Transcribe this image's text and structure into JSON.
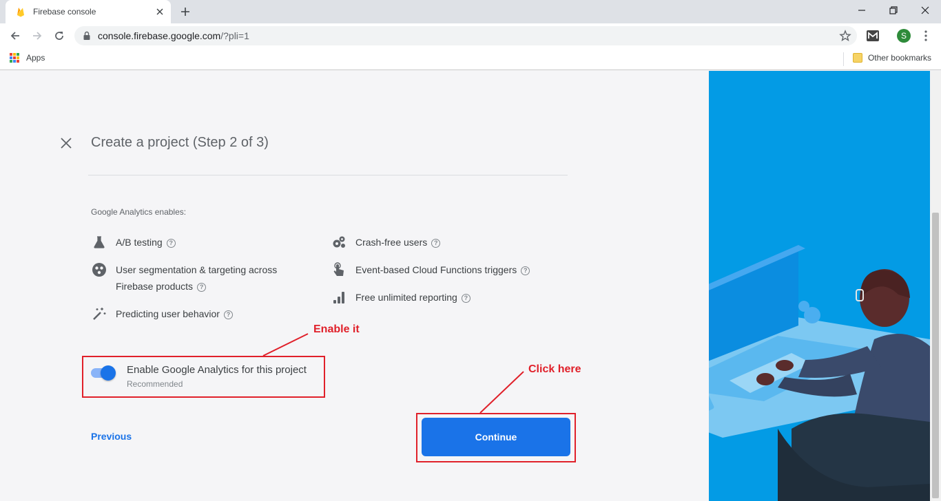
{
  "browser": {
    "tab_title": "Firebase console",
    "url_host": "console.firebase.google.com",
    "url_path": "/?pli=1",
    "profile_initial": "S",
    "bookmarks": {
      "apps_label": "Apps",
      "other_label": "Other bookmarks"
    }
  },
  "wizard": {
    "title": "Create a project (Step 2 of 3)",
    "enables_label": "Google Analytics enables:",
    "features_left": [
      {
        "label": "A/B testing",
        "icon": "flask-icon"
      },
      {
        "label": "User segmentation & targeting across",
        "label2": "Firebase products",
        "icon": "segmentation-icon"
      },
      {
        "label": "Predicting user behavior",
        "icon": "magic-wand-icon"
      }
    ],
    "features_right": [
      {
        "label": "Crash-free users",
        "icon": "gear-cluster-icon"
      },
      {
        "label": "Event-based Cloud Functions triggers",
        "icon": "touch-icon"
      },
      {
        "label": "Free unlimited reporting",
        "icon": "bar-chart-icon"
      }
    ],
    "toggle": {
      "label": "Enable Google Analytics for this project",
      "sublabel": "Recommended",
      "enabled": true
    },
    "previous_label": "Previous",
    "continue_label": "Continue"
  },
  "annotations": {
    "enable_it": "Enable it",
    "click_here": "Click here"
  },
  "colors": {
    "accent": "#1a73e8",
    "annotation": "#e0202a",
    "art_bg": "#039be5"
  }
}
